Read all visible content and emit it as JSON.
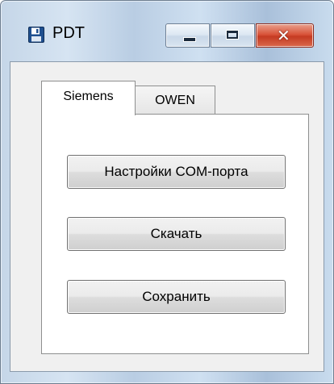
{
  "window": {
    "title": "PDT",
    "icon": "floppy-disk-icon"
  },
  "caption_buttons": {
    "minimize_icon": "minimize-icon",
    "maximize_icon": "maximize-icon",
    "close_glyph": "✕"
  },
  "tabs": [
    {
      "label": "Siemens",
      "selected": true
    },
    {
      "label": "OWEN",
      "selected": false
    }
  ],
  "siemens_panel": {
    "com_settings_label": "Настройки COM-порта",
    "download_label": "Скачать",
    "save_label": "Сохранить"
  },
  "colors": {
    "close_button": "#c53b22",
    "frame": "#c5d6e8",
    "client": "#f0f0f0"
  }
}
